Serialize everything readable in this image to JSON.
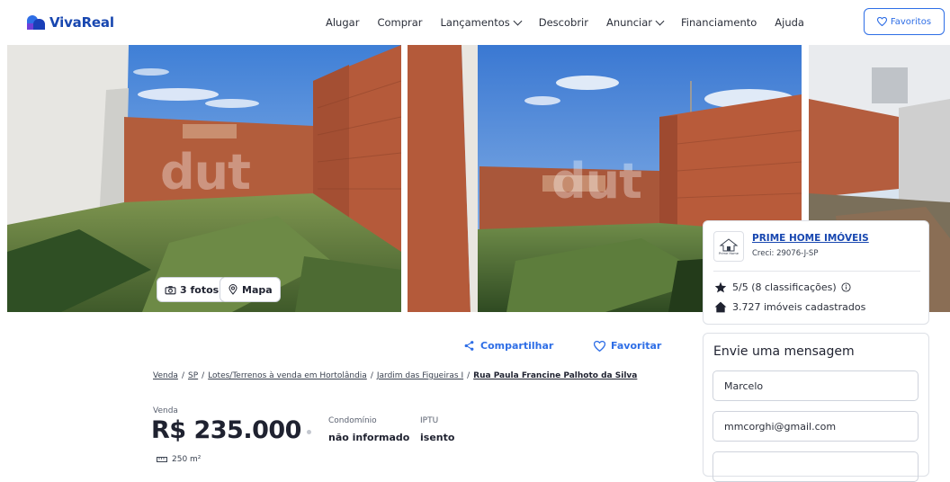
{
  "header": {
    "brand": "VivaReal",
    "nav": [
      {
        "label": "Alugar",
        "dropdown": false
      },
      {
        "label": "Comprar",
        "dropdown": false
      },
      {
        "label": "Lançamentos",
        "dropdown": true
      },
      {
        "label": "Descobrir",
        "dropdown": false
      },
      {
        "label": "Anunciar",
        "dropdown": true
      },
      {
        "label": "Financiamento",
        "dropdown": false
      },
      {
        "label": "Ajuda",
        "dropdown": false
      }
    ],
    "favorites_label": "Favoritos"
  },
  "gallery": {
    "photos_label": "3 fotos",
    "map_label": "Mapa",
    "watermark": "dut"
  },
  "agency": {
    "name": "PRIME HOME IMÓVEIS",
    "creci": "Creci: 29076-J-SP",
    "rating": "5/5 (8 classificações)",
    "listings": "3.727 imóveis cadastrados",
    "logo_text": "Prime Home"
  },
  "message": {
    "title": "Envie uma mensagem",
    "name_value": "Marcelo",
    "email_value": "mmcorghi@gmail.com"
  },
  "actions": {
    "share": "Compartilhar",
    "favorite": "Favoritar"
  },
  "breadcrumb": {
    "items": [
      "Venda",
      "SP",
      "Lotes/Terrenos à venda em Hortolândia",
      "Jardim das Figueiras I",
      "Rua Paula Francine Palhoto da Silva"
    ]
  },
  "listing": {
    "deal_type": "Venda",
    "price": "R$ 235.000",
    "condo_label": "Condomínio",
    "condo_value": "não informado",
    "iptu_label": "IPTU",
    "iptu_value": "isento",
    "area": "250 m²"
  },
  "colors": {
    "brand_blue": "#2e6ee6",
    "dark_blue": "#1847b0",
    "text": "#1f2230"
  }
}
